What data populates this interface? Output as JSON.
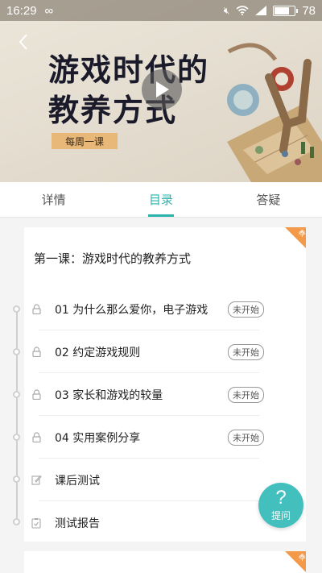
{
  "status_bar": {
    "time": "16:29",
    "battery": "78",
    "battery_level": 0.78
  },
  "banner": {
    "title_line1": "游戏时代的",
    "title_line2": "教养方式",
    "tag": "每周一课"
  },
  "tabs": [
    {
      "label": "详情"
    },
    {
      "label": "目录",
      "active": true
    },
    {
      "label": "答疑"
    }
  ],
  "course": {
    "corner_label": "教",
    "lesson_title": "第一课：游戏时代的教养方式",
    "items": [
      {
        "icon": "lock-icon",
        "label": "01 为什么那么爱你，电子游戏",
        "status": "未开始"
      },
      {
        "icon": "lock-icon",
        "label": "02 约定游戏规则",
        "status": "未开始"
      },
      {
        "icon": "lock-icon",
        "label": "03 家长和游戏的较量",
        "status": "未开始"
      },
      {
        "icon": "lock-icon",
        "label": "04 实用案例分享",
        "status": "未开始"
      },
      {
        "icon": "edit-icon",
        "label": "课后测试"
      },
      {
        "icon": "clipboard-check-icon",
        "label": "测试报告"
      }
    ]
  },
  "ask_button": {
    "symbol": "?",
    "label": "提问"
  },
  "colors": {
    "accent": "#2cb3ae",
    "tag": "#e8b878",
    "corner": "#f29a4a",
    "fab": "#43bfbd"
  }
}
